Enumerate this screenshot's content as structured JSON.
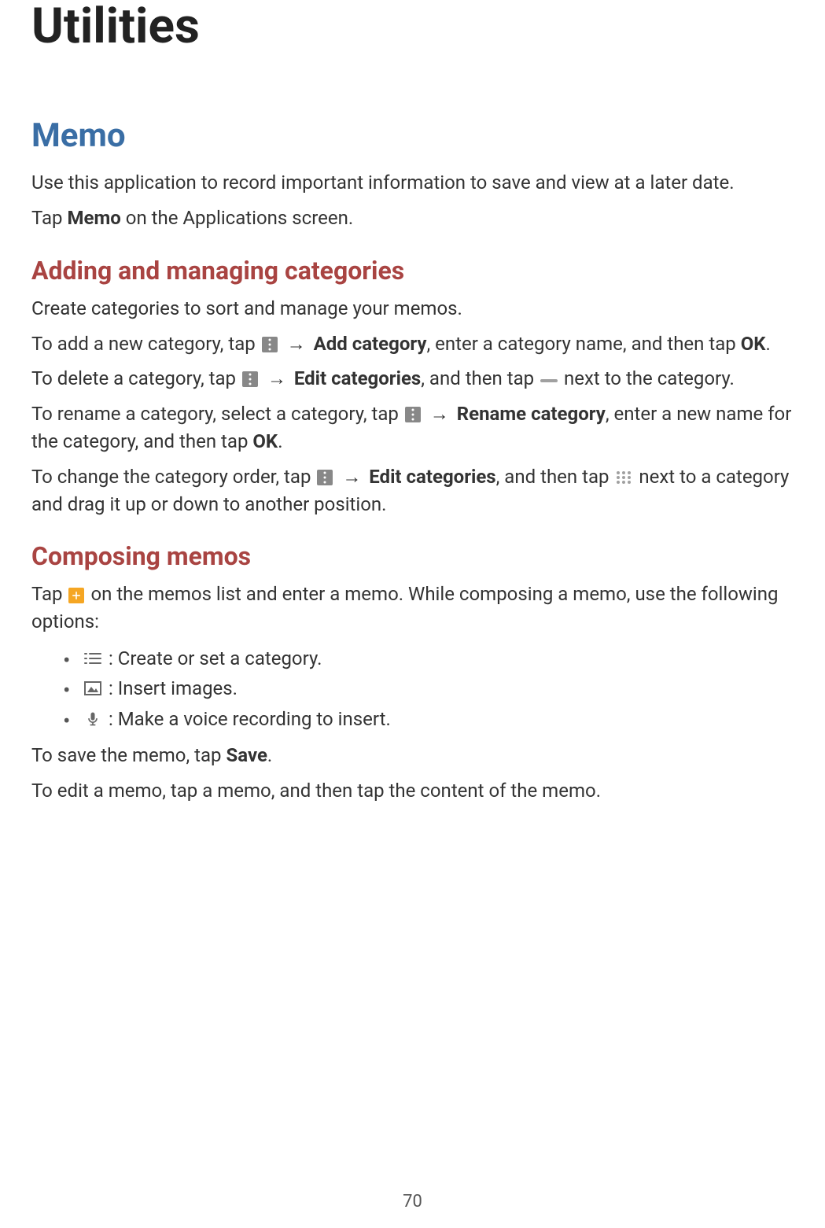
{
  "page": {
    "title": "Utilities",
    "number": "70"
  },
  "memo": {
    "heading": "Memo",
    "intro": "Use this application to record important information to save and view at a later date.",
    "tap_prefix": "Tap ",
    "tap_bold": "Memo",
    "tap_suffix": " on the Applications screen."
  },
  "categories": {
    "heading": "Adding and managing categories",
    "intro": "Create categories to sort and manage your memos.",
    "add": {
      "prefix": "To add a new category, tap ",
      "arrow": " → ",
      "bold1": "Add category",
      "mid": ", enter a category name, and then tap ",
      "bold2": "OK",
      "suffix": "."
    },
    "delete": {
      "prefix": "To delete a category, tap ",
      "arrow": " → ",
      "bold1": "Edit categories",
      "mid": ", and then tap ",
      "suffix": " next to the category."
    },
    "rename": {
      "prefix": "To rename a category, select a category, tap ",
      "arrow": " → ",
      "bold1": "Rename category",
      "mid": ", enter a new name for the category, and then tap ",
      "bold2": "OK",
      "suffix": "."
    },
    "reorder": {
      "prefix": "To change the category order, tap ",
      "arrow": " → ",
      "bold1": "Edit categories",
      "mid": ", and then tap ",
      "suffix": " next to a category and drag it up or down to another position."
    }
  },
  "composing": {
    "heading": "Composing memos",
    "intro_prefix": "Tap ",
    "intro_suffix": " on the memos list and enter a memo. While composing a memo, use the following options:",
    "bullets": {
      "b1": " : Create or set a category.",
      "b2": " : Insert images.",
      "b3": " : Make a voice recording to insert."
    },
    "save_prefix": "To save the memo, tap ",
    "save_bold": "Save",
    "save_suffix": ".",
    "edit_text": "To edit a memo, tap a memo, and then tap the content of the memo."
  }
}
